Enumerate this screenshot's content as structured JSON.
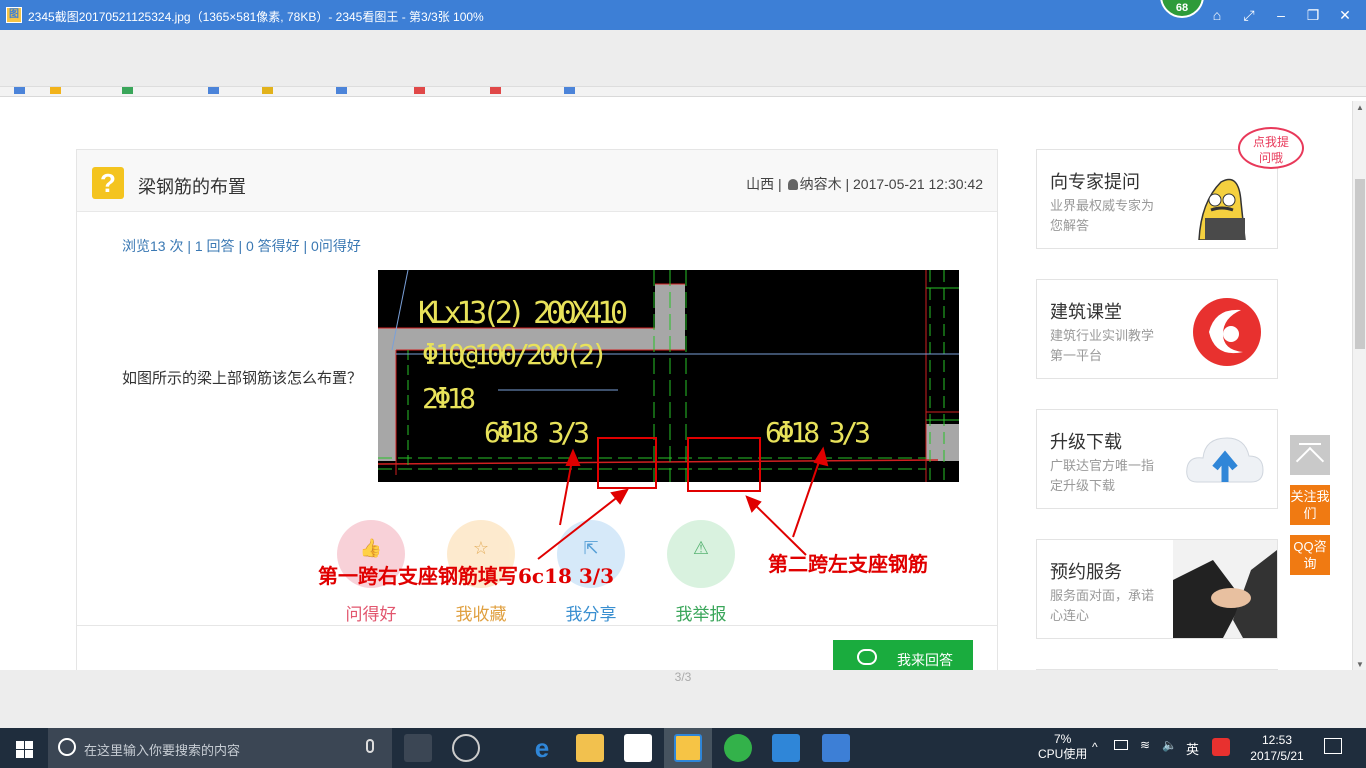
{
  "viewer": {
    "title": "2345截图20170521125324.jpg（1365×581像素, 78KB）- 2345看图王 - 第3/3张 100%",
    "badge": "68",
    "page_indicator": "3/3"
  },
  "question": {
    "title": "梁钢筋的布置",
    "location": "山西 |",
    "author": "纳容木",
    "date": "| 2017-05-21 12:30:42",
    "stats": "浏览13 次 | 1 回答 | 0 答得好 | 0问得好",
    "text": "如图所示的梁上部钢筋该怎么布置？"
  },
  "cad": {
    "label1": "KLx13(2) 200X410",
    "label2": "Φ10@100/200(2)",
    "label3": "2Φ18",
    "label4": "6Φ18 3/3",
    "label5": "6Φ18 3/3"
  },
  "annotations": {
    "left": "第一跨右支座钢筋填写6c18 3/3",
    "right": "第二跨左支座钢筋"
  },
  "actions": [
    {
      "label": "问得好",
      "color": "#e2566e",
      "bg": "#f7c9d2"
    },
    {
      "label": "我收藏",
      "color": "#e0a040",
      "bg": "#fde7c6"
    },
    {
      "label": "我分享",
      "color": "#3a8fd0",
      "bg": "#cfe6f9"
    },
    {
      "label": "我举报",
      "color": "#3aa65a",
      "bg": "#d3f0da"
    }
  ],
  "answer_button": "我来回答",
  "cards": [
    {
      "title": "向专家提问",
      "sub": "业界最权威专家为您解答",
      "bubble": "点我提问哦"
    },
    {
      "title": "建筑课堂",
      "sub": "建筑行业实训教学第一平台"
    },
    {
      "title": "升级下载",
      "sub": "广联达官方唯一指定升级下载"
    },
    {
      "title": "预约服务",
      "sub": "服务面对面，承诺心连心"
    }
  ],
  "side_buttons": {
    "follow": "关注我们",
    "qq": "QQ咨询"
  },
  "taskbar": {
    "search_placeholder": "在这里输入你要搜索的内容",
    "cpu_percent": "7%",
    "cpu_label": "CPU使用",
    "ime": "英",
    "time": "12:53",
    "date": "2017/5/21"
  }
}
